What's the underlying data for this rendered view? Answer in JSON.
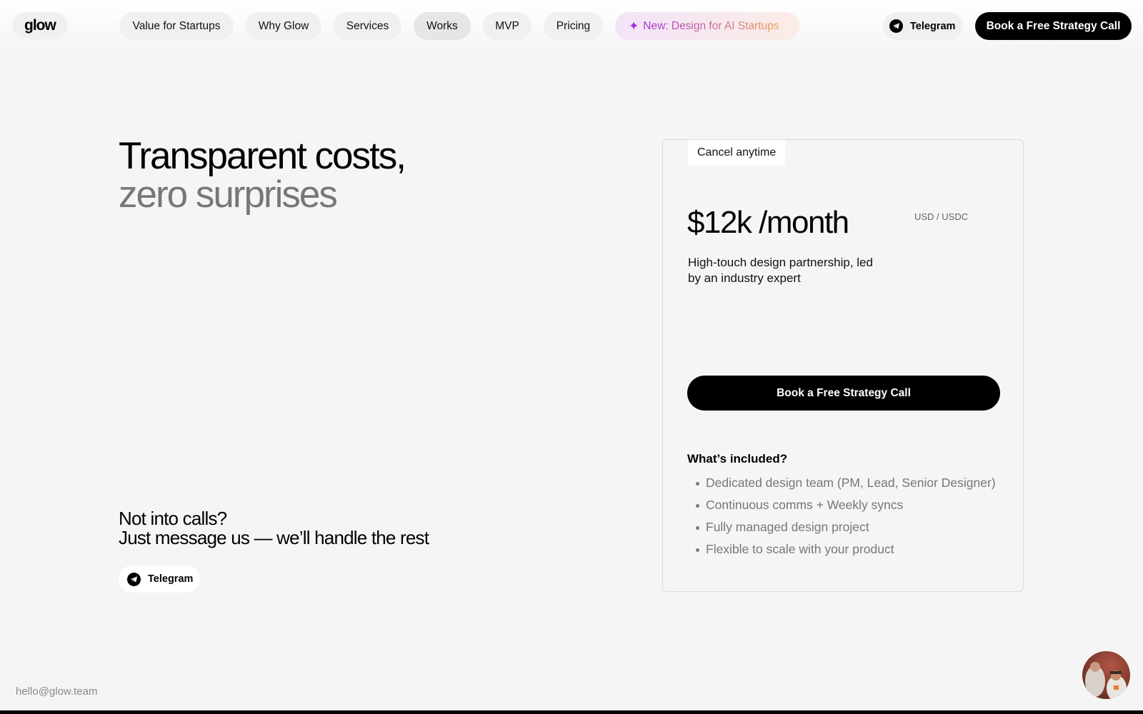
{
  "brand": {
    "logo_text": "glow"
  },
  "nav": {
    "items": [
      {
        "label": "Value for Startups"
      },
      {
        "label": "Why Glow"
      },
      {
        "label": "Services"
      },
      {
        "label": "Works",
        "active": true
      },
      {
        "label": "MVP"
      },
      {
        "label": "Pricing"
      }
    ],
    "ai_label": "New: Design for AI Startups",
    "ai_icon": "sparkle-icon",
    "telegram_label": "Telegram",
    "cta_label": "Book a Free Strategy Call"
  },
  "hero": {
    "title_line1": "Transparent costs,",
    "title_line2": "zero surprises"
  },
  "pricing": {
    "badge": "Cancel anytime",
    "price": "$12k /month",
    "currency": "USD / USDC",
    "description": "High-touch design partnership, led by an industry expert",
    "cta_label": "Book a Free Strategy Call",
    "included_title": "What’s included?",
    "included": [
      "Dedicated design team (PM, Lead, Senior Designer)",
      "Continuous comms + Weekly syncs",
      "Fully managed design project",
      "Flexible to scale with your product"
    ]
  },
  "calls": {
    "line1": "Not into calls?",
    "line2": "Just message us — we’ll handle the rest",
    "telegram_label": "Telegram"
  },
  "footer": {
    "email": "hello@glow.team"
  },
  "colors": {
    "background": "#f5f5f5",
    "primary": "#000000",
    "muted_text": "#777777",
    "ai_gradient_start": "#a634d0",
    "ai_gradient_end": "#e7a35a"
  }
}
